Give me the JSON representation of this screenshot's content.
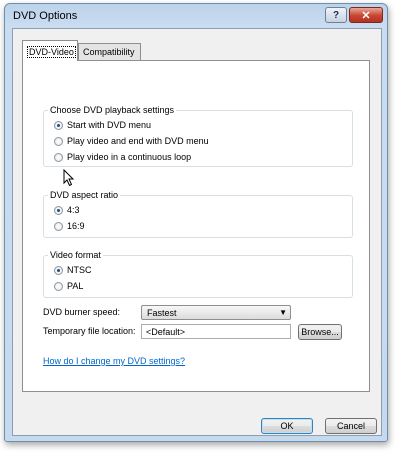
{
  "window": {
    "title": "DVD Options",
    "help_button": "?",
    "close_button": "✕"
  },
  "tabs": [
    {
      "label": "DVD-Video",
      "active": true
    },
    {
      "label": "Compatibility",
      "active": false
    }
  ],
  "playback": {
    "legend": "Choose DVD playback settings",
    "options": [
      {
        "label": "Start with DVD menu",
        "checked": true
      },
      {
        "label": "Play video and end with DVD menu",
        "checked": false
      },
      {
        "label": "Play video in a continuous loop",
        "checked": false
      }
    ]
  },
  "aspect": {
    "legend": "DVD aspect ratio",
    "options": [
      {
        "label": "4:3",
        "checked": true
      },
      {
        "label": "16:9",
        "checked": false
      }
    ]
  },
  "video_format": {
    "legend": "Video format",
    "options": [
      {
        "label": "NTSC",
        "checked": true
      },
      {
        "label": "PAL",
        "checked": false
      }
    ]
  },
  "burner_speed": {
    "label": "DVD burner speed:",
    "value": "Fastest"
  },
  "temp_location": {
    "label": "Temporary file location:",
    "value": "<Default>",
    "browse_label": "Browse..."
  },
  "help_link": "How do I change my DVD settings?",
  "buttons": {
    "ok": "OK",
    "cancel": "Cancel"
  },
  "colors": {
    "link": "#0066cc",
    "title_bar": "#c9dcf0",
    "close_button": "#c7452f"
  }
}
